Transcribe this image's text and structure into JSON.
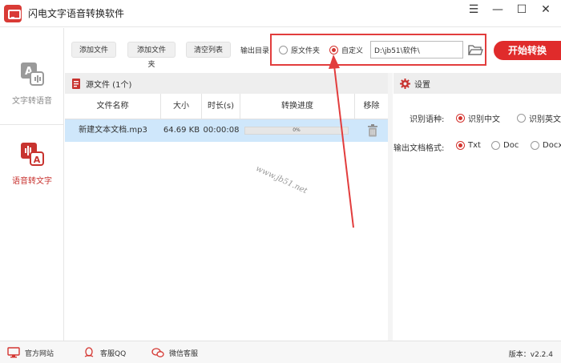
{
  "app": {
    "title": "闪电文字语音转换软件",
    "accent": "#e02b2b"
  },
  "window": {
    "menu_glyph": "☰",
    "minimize_glyph": "—",
    "maximize_glyph": "☐",
    "close_glyph": "✕"
  },
  "sidebar": {
    "items": [
      {
        "label": "文字转语音",
        "icon": "text-to-speech-icon",
        "active": false
      },
      {
        "label": "语音转文字",
        "icon": "speech-to-text-icon",
        "active": true
      }
    ]
  },
  "toolbar": {
    "add_file": "添加文件",
    "add_folder": "添加文件夹",
    "clear_list": "清空列表",
    "output_dir_label": "输出目录",
    "radio_original": "原文件夹",
    "radio_custom": "自定义",
    "selected_radio": "custom",
    "path_value": "D:\\jb51\\软件\\",
    "folder_icon": "folder-open-icon",
    "start_button": "开始转换"
  },
  "source": {
    "title": "源文件 (1个)",
    "columns": [
      "文件名称",
      "大小",
      "时长(s)",
      "转换进度",
      "移除"
    ],
    "rows": [
      {
        "name": "新建文本文档.mp3",
        "size": "64.69 KB",
        "duration": "00:00:08",
        "progress": "0%",
        "progress_value": 0
      }
    ]
  },
  "settings": {
    "title": "设置",
    "language_label": "识别语种:",
    "language_options": [
      "识别中文",
      "识别英文"
    ],
    "language_selected": 0,
    "format_label": "输出文档格式:",
    "format_options": [
      "Txt",
      "Doc",
      "Docx"
    ],
    "format_selected": 0
  },
  "watermark": "www.jb51.net",
  "footer": {
    "website": "官方网站",
    "qq": "客服QQ",
    "wechat": "微信客服",
    "version": "版本：v2.2.4"
  }
}
